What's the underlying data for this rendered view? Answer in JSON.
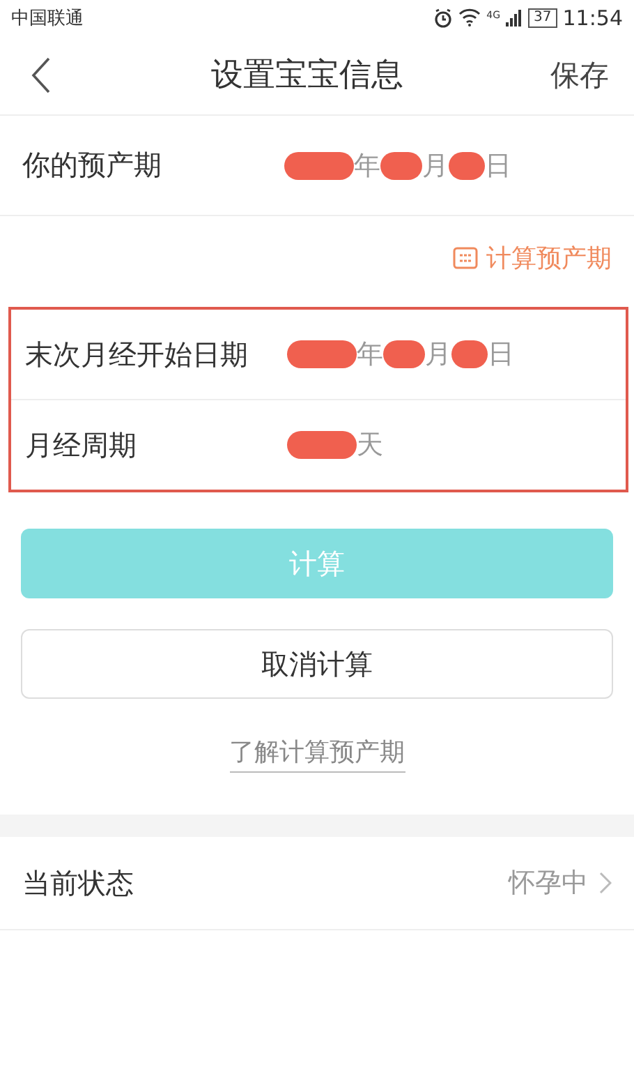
{
  "status_bar": {
    "carrier": "中国联通",
    "network": "4G",
    "battery": "37",
    "time": "11:54"
  },
  "nav": {
    "title": "设置宝宝信息",
    "action": "保存"
  },
  "due_date": {
    "label": "你的预产期",
    "value_parts": [
      {
        "text": "年",
        "redacted": true
      },
      {
        "text": "月",
        "redacted": true
      },
      {
        "text": "日",
        "redacted": true
      }
    ]
  },
  "calc_link": "计算预产期",
  "calc_section": {
    "highlighted": true,
    "rows": [
      {
        "label": "末次月经开始日期",
        "value_parts": [
          {
            "text": "年",
            "redacted": true
          },
          {
            "text": "月",
            "redacted": true
          },
          {
            "text": "日",
            "redacted": true
          }
        ]
      },
      {
        "label": "月经周期",
        "value_parts": [
          {
            "text": "天",
            "redacted": true
          }
        ]
      }
    ]
  },
  "buttons": [
    {
      "label": "计算",
      "kind": "primary",
      "disabled": true
    },
    {
      "label": "取消计算",
      "kind": "secondary",
      "disabled": false
    }
  ],
  "info_link": "了解计算预产期",
  "status_row": {
    "label": "当前状态",
    "value": "怀孕中"
  }
}
